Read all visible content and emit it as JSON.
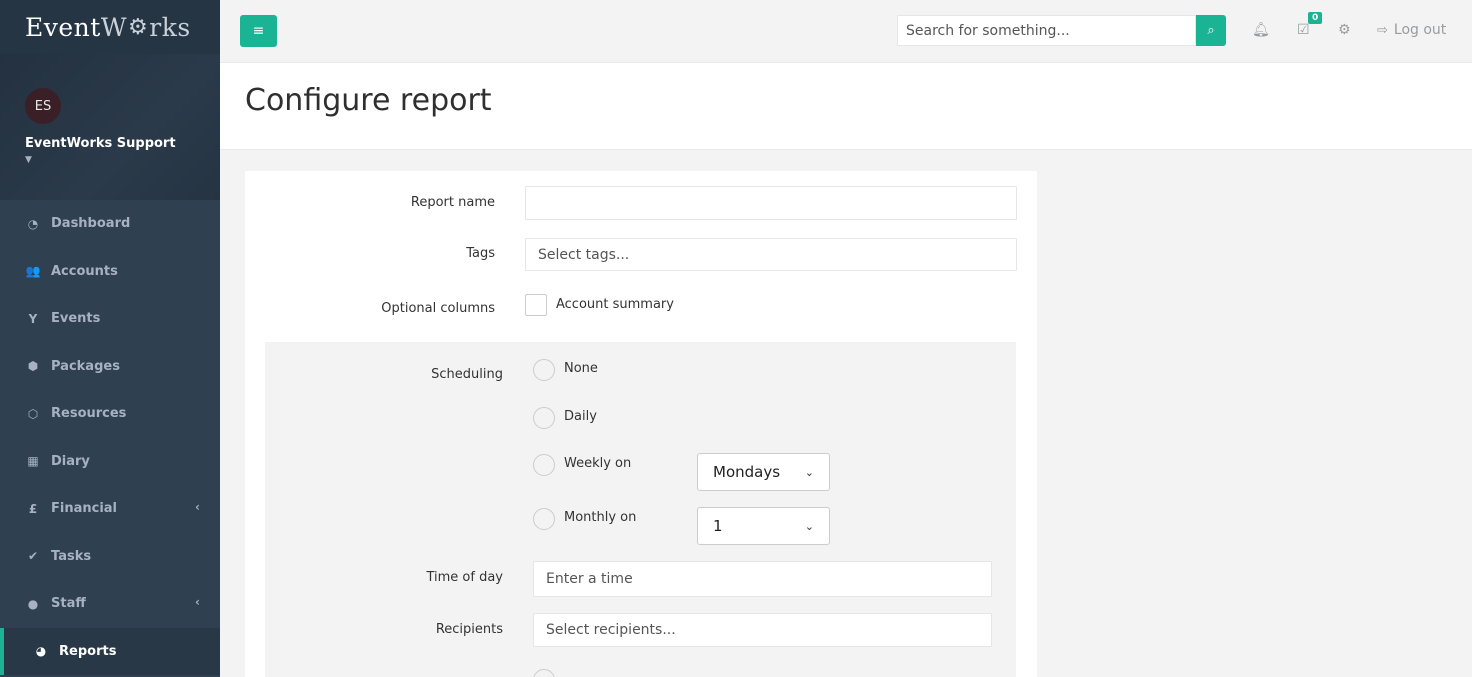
{
  "brand": {
    "name_part1": "Event",
    "name_part2": "W",
    "name_part3": "rks"
  },
  "profile": {
    "initials": "ES",
    "name": "EventWorks Support"
  },
  "sidebar": {
    "items": [
      {
        "label": "Dashboard",
        "icon": "dashboard-icon"
      },
      {
        "label": "Accounts",
        "icon": "users-icon"
      },
      {
        "label": "Events",
        "icon": "glass-icon"
      },
      {
        "label": "Packages",
        "icon": "cubes-icon"
      },
      {
        "label": "Resources",
        "icon": "cube-icon"
      },
      {
        "label": "Diary",
        "icon": "calendar-icon"
      },
      {
        "label": "Financial",
        "icon": "pound-icon"
      },
      {
        "label": "Tasks",
        "icon": "check-icon"
      },
      {
        "label": "Staff",
        "icon": "user-icon"
      },
      {
        "label": "Reports",
        "icon": "pie-chart-icon"
      }
    ],
    "active": "Reports"
  },
  "topbar": {
    "search_placeholder": "Search for something...",
    "tasks_badge": "0",
    "logout_label": "Log out"
  },
  "page": {
    "title": "Configure report"
  },
  "form": {
    "report_name_label": "Report name",
    "report_name_value": "",
    "tags_label": "Tags",
    "tags_placeholder": "Select tags...",
    "optional_columns_label": "Optional columns",
    "account_summary_label": "Account summary",
    "scheduling_label": "Scheduling",
    "schedule_options": [
      "None",
      "Daily",
      "Weekly on",
      "Monthly on"
    ],
    "weekly_selected": "Mondays",
    "monthly_selected": "1",
    "time_of_day_label": "Time of day",
    "time_placeholder": "Enter a time",
    "recipients_label": "Recipients",
    "recipients_placeholder": "Select recipients..."
  },
  "colors": {
    "accent": "#1ab394",
    "sidebar": "#2f4050"
  }
}
